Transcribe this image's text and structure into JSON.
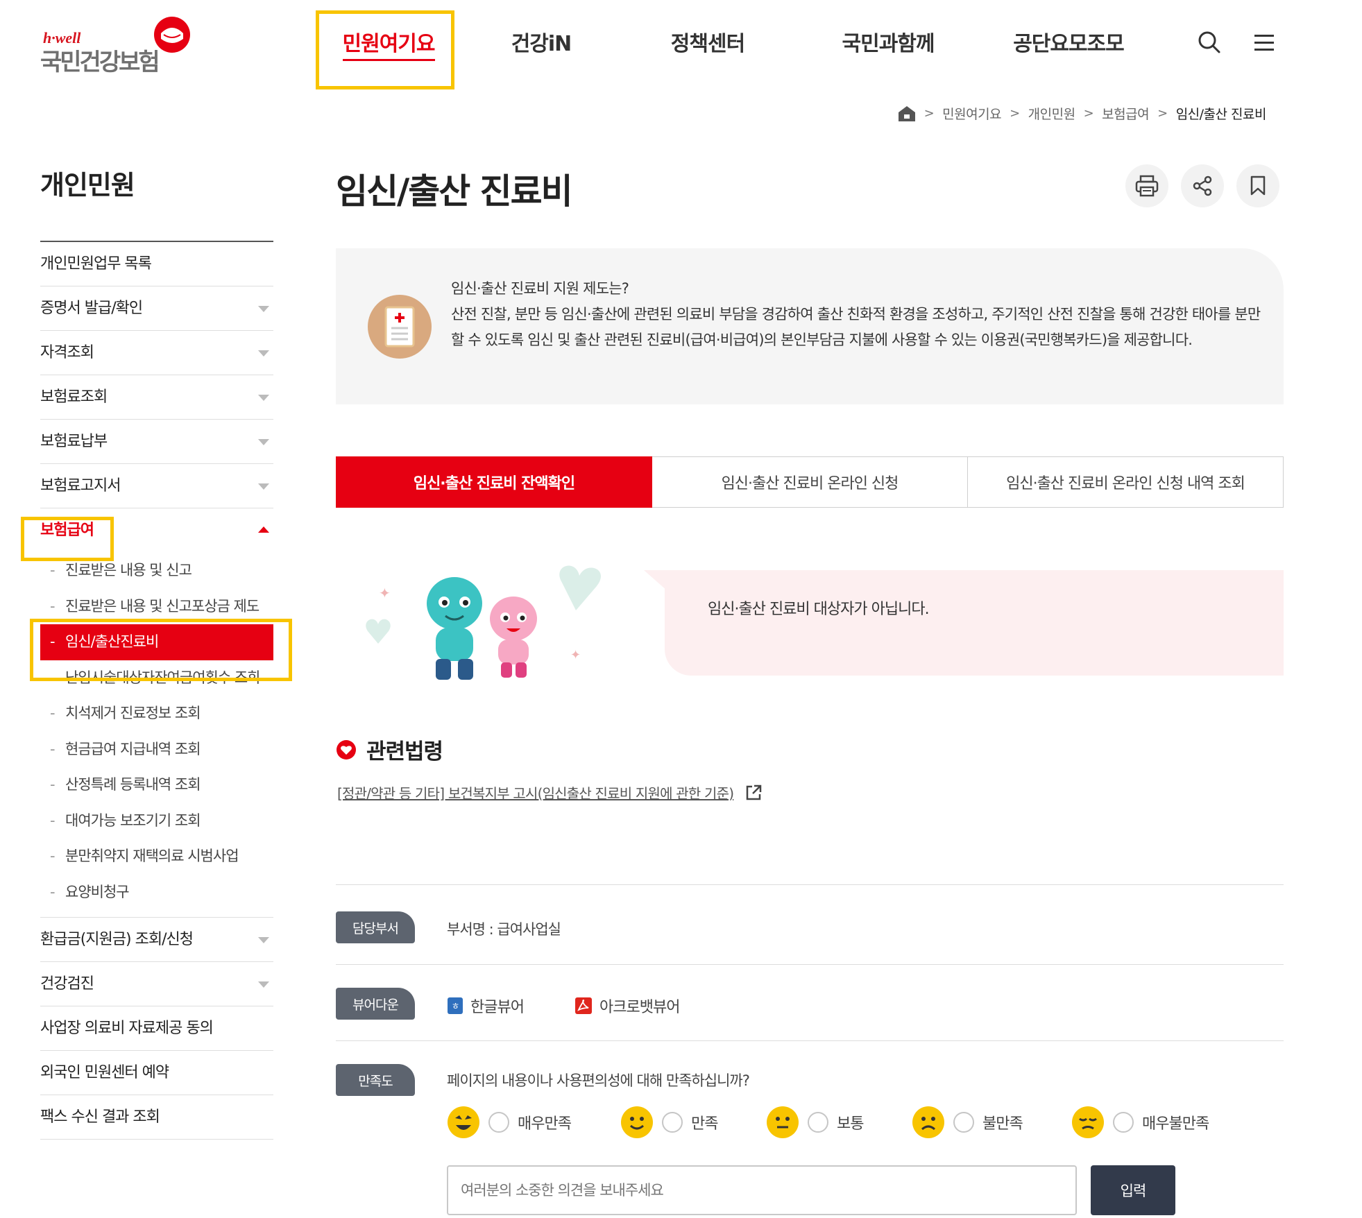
{
  "header": {
    "logo_small": "h·well",
    "logo_main": "국민건강보험",
    "nav": [
      "민원여기요",
      "건강iN",
      "정책센터",
      "국민과함께",
      "공단요모조모"
    ],
    "active_nav": 0
  },
  "breadcrumb": [
    "민원여기요",
    "개인민원",
    "보험급여",
    "임신/출산 진료비"
  ],
  "sidebar": {
    "title": "개인민원",
    "items_top": [
      {
        "label": "개인민원업무 목록",
        "arrow": false
      },
      {
        "label": "증명서 발급/확인",
        "arrow": true
      },
      {
        "label": "자격조회",
        "arrow": true
      },
      {
        "label": "보험료조회",
        "arrow": true
      },
      {
        "label": "보험료납부",
        "arrow": true
      },
      {
        "label": "보험료고지서",
        "arrow": true
      }
    ],
    "open_item": "보험급여",
    "sub_items": [
      "진료받은 내용 및 신고",
      "진료받은 내용 및 신고포상금 제도",
      "임신/출산진료비",
      "난임시술대상자잔여급여횟수 조회",
      "치석제거 진료정보 조회",
      "현금급여 지급내역 조회",
      "산정특례 등록내역 조회",
      "대여가능 보조기기 조회",
      "분만취약지 재택의료 시범사업",
      "요양비청구"
    ],
    "active_sub": 2,
    "items_bottom": [
      {
        "label": "환급금(지원금) 조회/신청",
        "arrow": true
      },
      {
        "label": "건강검진",
        "arrow": true
      },
      {
        "label": "사업장 의료비 자료제공 동의",
        "arrow": false
      },
      {
        "label": "외국인 민원센터 예약",
        "arrow": false
      },
      {
        "label": "팩스 수신 결과 조회",
        "arrow": false
      }
    ]
  },
  "main": {
    "title": "임신/출산 진료비",
    "info_question": "임신·출산 진료비 지원 제도는?",
    "info_body": "산전 진찰, 분만 등 임신·출산에 관련된 의료비 부담을 경감하여 출산 친화적 환경을 조성하고, 주기적인 산전 진찰을 통해 건강한 태아를 분만할 수 있도록 임신 및 출산 관련된 진료비(급여·비급여)의 본인부담금 지불에 사용할 수 있는 이용권(국민행복카드)을 제공합니다.",
    "tabs": [
      "임신·출산 진료비 잔액확인",
      "임신·출산 진료비 온라인 신청",
      "임신·출산 진료비 온라인 신청 내역 조회"
    ],
    "active_tab": 0,
    "result_message": "임신·출산 진료비 대상자가 아닙니다.",
    "law_title": "관련법령",
    "law_link": "[정관/약관 등 기타] 보건복지부 고시(임신출산 진료비 지원에 관한 기준)"
  },
  "footer_info": {
    "dept_badge": "담당부서",
    "dept_text": "부서명 : 급여사업실",
    "viewer_badge": "뷰어다운",
    "viewers": [
      "한글뷰어",
      "아크로뱃뷰어"
    ],
    "sat_badge": "만족도",
    "sat_question": "페이지의 내용이나 사용편의성에 대해 만족하십니까?",
    "sat_options": [
      "매우만족",
      "만족",
      "보통",
      "불만족",
      "매우불만족"
    ],
    "opinion_placeholder": "여러분의 소중한 의견을 보내주세요",
    "submit_label": "입력"
  },
  "colors": {
    "brand_red": "#e60012",
    "highlight_yellow": "#f8c400",
    "badge_gray": "#5d646f",
    "submit_navy": "#323a4b"
  },
  "icons": [
    "home-icon",
    "search-icon",
    "menu-icon",
    "print-icon",
    "share-icon",
    "bookmark-icon",
    "document-icon",
    "heart-bullet-icon",
    "external-link-icon",
    "hangul-viewer-icon",
    "acrobat-viewer-icon"
  ]
}
